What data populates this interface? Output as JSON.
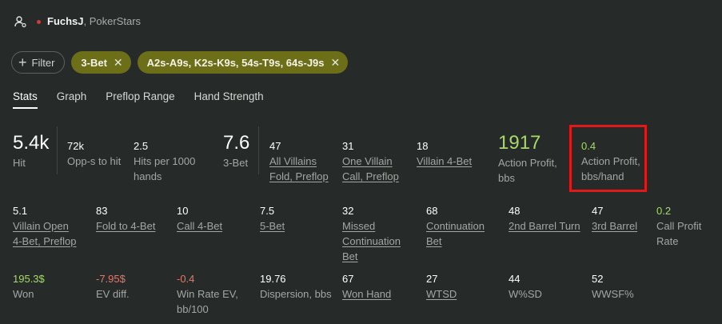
{
  "header": {
    "name": "FuchsJ",
    "site": ", PokerStars"
  },
  "filters": {
    "filter_label": "Filter",
    "chips": [
      {
        "label": "3-Bet"
      },
      {
        "label": "A2s-A9s, K2s-K9s, 54s-T9s, 64s-J9s"
      }
    ]
  },
  "tabs": [
    "Stats",
    "Graph",
    "Preflop Range",
    "Hand Strength"
  ],
  "row1": [
    {
      "value": "5.4k",
      "label": "Hit"
    },
    {
      "value": "72k",
      "label": "Opp-s to hit"
    },
    {
      "value": "2.5",
      "label": "Hits per 1000 hands"
    },
    {
      "value": "7.6",
      "label": "3-Bet"
    },
    {
      "value": "47",
      "label": "All Villains Fold, Preflop"
    },
    {
      "value": "31",
      "label": "One Villain Call, Preflop"
    },
    {
      "value": "18",
      "label": "Villain 4-Bet"
    },
    {
      "value": "1917",
      "label": "Action Profit, bbs"
    },
    {
      "value": "0.4",
      "label": "Action Profit, bbs/hand"
    }
  ],
  "row2": [
    {
      "value": "5.1",
      "label": "Villain Open 4-Bet, Preflop"
    },
    {
      "value": "83",
      "label": "Fold to 4-Bet"
    },
    {
      "value": "10",
      "label": "Call 4-Bet"
    },
    {
      "value": "7.5",
      "label": "5-Bet"
    },
    {
      "value": "32",
      "label": "Missed Continuation Bet"
    },
    {
      "value": "68",
      "label": "Continuation Bet"
    },
    {
      "value": "48",
      "label": "2nd Barrel Turn"
    },
    {
      "value": "47",
      "label": "3rd Barrel"
    },
    {
      "value": "0.2",
      "label": "Call Profit Rate"
    }
  ],
  "row3": [
    {
      "value": "195.3$",
      "label": "Won"
    },
    {
      "value": "-7.95$",
      "label": "EV diff."
    },
    {
      "value": "-0.4",
      "label": "Win Rate EV, bb/100"
    },
    {
      "value": "19.76",
      "label": "Dispersion, bbs"
    },
    {
      "value": "67",
      "label": "Won Hand"
    },
    {
      "value": "27",
      "label": "WTSD"
    },
    {
      "value": "44",
      "label": "W%SD"
    },
    {
      "value": "52",
      "label": "WWSF%"
    }
  ],
  "colors": {
    "positive": "#a6d96a",
    "negative": "#e4766a",
    "chip": "#6c6e18",
    "highlight": "#e01a1a"
  }
}
